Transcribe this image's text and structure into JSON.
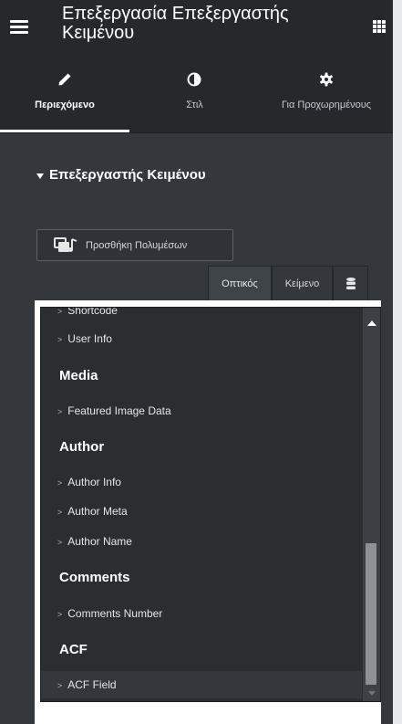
{
  "header": {
    "title": "Επεξεργασία Επεξεργαστής Κειμένου",
    "menu_icon": "hamburger-icon",
    "apps_icon": "grid-icon"
  },
  "tabs": [
    {
      "label": "Περιεχόμενο",
      "icon": "pencil-icon",
      "active": true
    },
    {
      "label": "Στιλ",
      "icon": "contrast-icon",
      "active": false
    },
    {
      "label": "Για Προχωρημένους",
      "icon": "gear-icon",
      "active": false
    }
  ],
  "section": {
    "title": "Επεξεργαστής Κειμένου"
  },
  "media_button": {
    "label": "Προσθήκη Πολυμέσων",
    "icon": "media-icon"
  },
  "editor_tabs": {
    "visual": "Οπτικός",
    "text": "Κείμενο",
    "dynamic_icon": "database-icon"
  },
  "dropdown": {
    "partial_item": "Shortcode",
    "site_items": [
      "User Info"
    ],
    "groups": [
      {
        "name": "Media",
        "items": [
          "Featured Image Data"
        ]
      },
      {
        "name": "Author",
        "items": [
          "Author Info",
          "Author Meta",
          "Author Name"
        ]
      },
      {
        "name": "Comments",
        "items": [
          "Comments Number"
        ]
      },
      {
        "name": "ACF",
        "items": [
          "ACF Field"
        ]
      }
    ]
  },
  "colors": {
    "panel_bg": "#34383c",
    "header_bg": "#26292c",
    "dropdown_bg": "#2b2e31",
    "text_primary": "#ffffff"
  }
}
